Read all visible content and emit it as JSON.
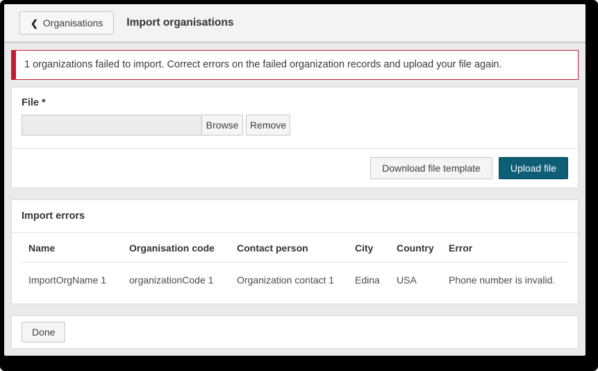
{
  "header": {
    "back_icon": "❮",
    "back_label": "Organisations",
    "title": "Import organisations"
  },
  "alert": {
    "message": "1 organizations failed to import. Correct errors on the failed organization records and upload your file again."
  },
  "file_section": {
    "label": "File *",
    "input_value": "",
    "browse_label": "Browse",
    "remove_label": "Remove",
    "download_template_label": "Download file template",
    "upload_label": "Upload file"
  },
  "import_errors": {
    "title": "Import errors",
    "columns": [
      "Name",
      "Organisation code",
      "Contact person",
      "City",
      "Country",
      "Error"
    ],
    "rows": [
      [
        "ImportOrgName 1",
        "organizationCode 1",
        "Organization contact 1",
        "Edina",
        "USA",
        "Phone number is invalid."
      ]
    ]
  },
  "footer": {
    "done_label": "Done"
  },
  "colors": {
    "alert_red": "#c41b33",
    "primary_teal": "#0f5e78"
  }
}
